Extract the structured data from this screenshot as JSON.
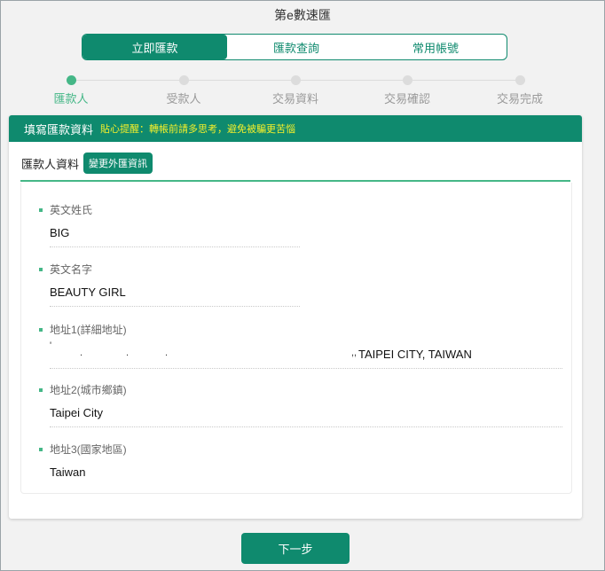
{
  "app_title": "第e數速匯",
  "tabs": [
    {
      "label": "立即匯款",
      "active": true
    },
    {
      "label": "匯款查詢",
      "active": false
    },
    {
      "label": "常用帳號",
      "active": false
    }
  ],
  "steps": [
    {
      "label": "匯款人",
      "active": true
    },
    {
      "label": "受款人",
      "active": false
    },
    {
      "label": "交易資料",
      "active": false
    },
    {
      "label": "交易確認",
      "active": false
    },
    {
      "label": "交易完成",
      "active": false
    }
  ],
  "panel": {
    "title": "填寫匯款資料",
    "tip": "貼心提醒：轉帳前請多思考，避免被騙更苦惱"
  },
  "section": {
    "title": "匯款人資料",
    "change_button": "變更外匯資訊"
  },
  "fields": {
    "last_name": {
      "label": "英文姓氏",
      "value": "BIG"
    },
    "first_name": {
      "label": "英文名字",
      "value": "BEAUTY GIRL"
    },
    "address1": {
      "label": "地址1(詳細地址)",
      "value": "TAIPEI CITY, TAIWAN"
    },
    "address2": {
      "label": "地址2(城市鄉鎮)",
      "value": "Taipei City"
    },
    "address3": {
      "label": "地址3(國家地區)",
      "value": "Taiwan"
    }
  },
  "next_button": "下一步",
  "colors": {
    "primary": "#0f8a6e",
    "accent": "#45b787",
    "tip": "#f3ef2b"
  }
}
